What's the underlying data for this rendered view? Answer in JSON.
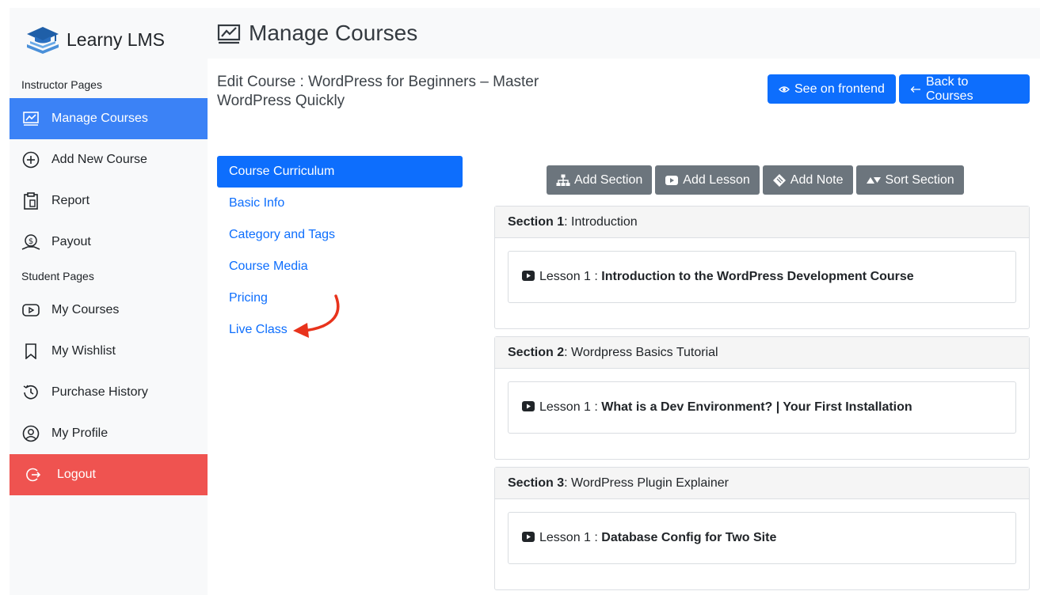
{
  "brand": {
    "name": "Learny LMS"
  },
  "sidebar": {
    "instructor_label": "Instructor Pages",
    "student_label": "Student Pages",
    "instructor_items": [
      {
        "label": "Manage Courses",
        "icon": "chart-icon"
      },
      {
        "label": "Add New Course",
        "icon": "plus-circle-icon"
      },
      {
        "label": "Report",
        "icon": "clipboard-icon"
      },
      {
        "label": "Payout",
        "icon": "money-icon"
      }
    ],
    "student_items": [
      {
        "label": "My Courses",
        "icon": "play-square-icon"
      },
      {
        "label": "My Wishlist",
        "icon": "bookmark-icon"
      },
      {
        "label": "Purchase History",
        "icon": "history-icon"
      },
      {
        "label": "My Profile",
        "icon": "user-circle-icon"
      }
    ],
    "logout": "Logout"
  },
  "header": {
    "title": "Manage Courses"
  },
  "edit": {
    "title": "Edit Course : WordPress for Beginners – Master WordPress Quickly",
    "frontend_btn": "See on frontend",
    "back_btn": "Back to Courses"
  },
  "tabs": [
    "Course Curriculum",
    "Basic Info",
    "Category and Tags",
    "Course Media",
    "Pricing",
    "Live Class"
  ],
  "toolbar": {
    "add_section": "Add Section",
    "add_lesson": "Add Lesson",
    "add_note": "Add Note",
    "sort_section": "Sort Section"
  },
  "sections": [
    {
      "label": "Section 1",
      "name": " : Introduction",
      "lesson_label": "Lesson 1 : ",
      "lesson_title": "Introduction to the WordPress Development Course"
    },
    {
      "label": "Section 2",
      "name": " : Wordpress Basics Tutorial",
      "lesson_label": "Lesson 1 : ",
      "lesson_title": "What is a Dev Environment? | Your First Installation"
    },
    {
      "label": "Section 3",
      "name": " : WordPress Plugin Explainer",
      "lesson_label": "Lesson 1 : ",
      "lesson_title": "Database Config for Two Site"
    }
  ],
  "colors": {
    "primary": "#0d6efd",
    "sidebar_active": "#3b82f6",
    "logout": "#ef5350",
    "secondary": "#6c757d",
    "annotation_arrow": "#e8331c"
  }
}
